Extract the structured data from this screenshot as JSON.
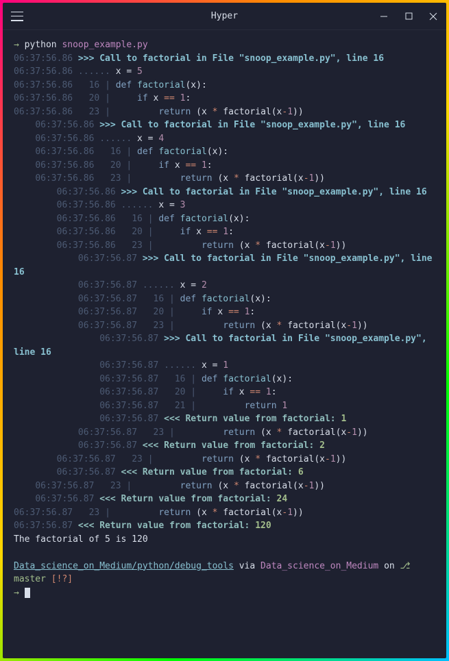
{
  "window": {
    "title": "Hyper"
  },
  "prompt": {
    "arrow": "→",
    "command": "python",
    "arg": "snoop_example.py"
  },
  "lines": [
    {
      "indent": 0,
      "ts": "06:37:56.86",
      "type": "call",
      "text": ">>> Call to factorial in File \"snoop_example.py\", line 16"
    },
    {
      "indent": 0,
      "ts": "06:37:56.86",
      "type": "var",
      "var": "x",
      "val": "5"
    },
    {
      "indent": 0,
      "ts": "06:37:56.86",
      "type": "code",
      "ln": "16",
      "parts": [
        {
          "t": "kw",
          "s": "def "
        },
        {
          "t": "fn",
          "s": "factorial"
        },
        {
          "t": "",
          "s": "(x):"
        }
      ]
    },
    {
      "indent": 0,
      "ts": "06:37:56.86",
      "type": "code",
      "ln": "20",
      "parts": [
        {
          "t": "",
          "s": "    "
        },
        {
          "t": "kw",
          "s": "if"
        },
        {
          "t": "",
          "s": " x "
        },
        {
          "t": "op",
          "s": "=="
        },
        {
          "t": "",
          "s": " "
        },
        {
          "t": "num",
          "s": "1"
        },
        {
          "t": "",
          "s": ":"
        }
      ]
    },
    {
      "indent": 0,
      "ts": "06:37:56.86",
      "type": "code",
      "ln": "23",
      "parts": [
        {
          "t": "",
          "s": "        "
        },
        {
          "t": "kw",
          "s": "return"
        },
        {
          "t": "",
          "s": " (x "
        },
        {
          "t": "op",
          "s": "*"
        },
        {
          "t": "",
          "s": " factorial(x"
        },
        {
          "t": "op",
          "s": "-"
        },
        {
          "t": "num",
          "s": "1"
        },
        {
          "t": "",
          "s": "))"
        }
      ]
    },
    {
      "indent": 1,
      "ts": "06:37:56.86",
      "type": "call",
      "text": ">>> Call to factorial in File \"snoop_example.py\", line 16"
    },
    {
      "indent": 1,
      "ts": "06:37:56.86",
      "type": "var",
      "var": "x",
      "val": "4"
    },
    {
      "indent": 1,
      "ts": "06:37:56.86",
      "type": "code",
      "ln": "16",
      "parts": [
        {
          "t": "kw",
          "s": "def "
        },
        {
          "t": "fn",
          "s": "factorial"
        },
        {
          "t": "",
          "s": "(x):"
        }
      ]
    },
    {
      "indent": 1,
      "ts": "06:37:56.86",
      "type": "code",
      "ln": "20",
      "parts": [
        {
          "t": "",
          "s": "    "
        },
        {
          "t": "kw",
          "s": "if"
        },
        {
          "t": "",
          "s": " x "
        },
        {
          "t": "op",
          "s": "=="
        },
        {
          "t": "",
          "s": " "
        },
        {
          "t": "num",
          "s": "1"
        },
        {
          "t": "",
          "s": ":"
        }
      ]
    },
    {
      "indent": 1,
      "ts": "06:37:56.86",
      "type": "code",
      "ln": "23",
      "parts": [
        {
          "t": "",
          "s": "        "
        },
        {
          "t": "kw",
          "s": "return"
        },
        {
          "t": "",
          "s": " (x "
        },
        {
          "t": "op",
          "s": "*"
        },
        {
          "t": "",
          "s": " factorial(x"
        },
        {
          "t": "op",
          "s": "-"
        },
        {
          "t": "num",
          "s": "1"
        },
        {
          "t": "",
          "s": "))"
        }
      ]
    },
    {
      "indent": 2,
      "ts": "06:37:56.86",
      "type": "call",
      "text": ">>> Call to factorial in File \"snoop_example.py\", line 16"
    },
    {
      "indent": 2,
      "ts": "06:37:56.86",
      "type": "var",
      "var": "x",
      "val": "3"
    },
    {
      "indent": 2,
      "ts": "06:37:56.86",
      "type": "code",
      "ln": "16",
      "parts": [
        {
          "t": "kw",
          "s": "def "
        },
        {
          "t": "fn",
          "s": "factorial"
        },
        {
          "t": "",
          "s": "(x):"
        }
      ]
    },
    {
      "indent": 2,
      "ts": "06:37:56.86",
      "type": "code",
      "ln": "20",
      "parts": [
        {
          "t": "",
          "s": "    "
        },
        {
          "t": "kw",
          "s": "if"
        },
        {
          "t": "",
          "s": " x "
        },
        {
          "t": "op",
          "s": "=="
        },
        {
          "t": "",
          "s": " "
        },
        {
          "t": "num",
          "s": "1"
        },
        {
          "t": "",
          "s": ":"
        }
      ]
    },
    {
      "indent": 2,
      "ts": "06:37:56.86",
      "type": "code",
      "ln": "23",
      "parts": [
        {
          "t": "",
          "s": "        "
        },
        {
          "t": "kw",
          "s": "return"
        },
        {
          "t": "",
          "s": " (x "
        },
        {
          "t": "op",
          "s": "*"
        },
        {
          "t": "",
          "s": " factorial(x"
        },
        {
          "t": "op",
          "s": "-"
        },
        {
          "t": "num",
          "s": "1"
        },
        {
          "t": "",
          "s": "))"
        }
      ]
    },
    {
      "indent": 3,
      "ts": "06:37:56.87",
      "type": "call",
      "text": ">>> Call to factorial in File \"snoop_example.py\", line 16"
    },
    {
      "indent": 3,
      "ts": "06:37:56.87",
      "type": "var",
      "var": "x",
      "val": "2"
    },
    {
      "indent": 3,
      "ts": "06:37:56.87",
      "type": "code",
      "ln": "16",
      "parts": [
        {
          "t": "kw",
          "s": "def "
        },
        {
          "t": "fn",
          "s": "factorial"
        },
        {
          "t": "",
          "s": "(x):"
        }
      ]
    },
    {
      "indent": 3,
      "ts": "06:37:56.87",
      "type": "code",
      "ln": "20",
      "parts": [
        {
          "t": "",
          "s": "    "
        },
        {
          "t": "kw",
          "s": "if"
        },
        {
          "t": "",
          "s": " x "
        },
        {
          "t": "op",
          "s": "=="
        },
        {
          "t": "",
          "s": " "
        },
        {
          "t": "num",
          "s": "1"
        },
        {
          "t": "",
          "s": ":"
        }
      ]
    },
    {
      "indent": 3,
      "ts": "06:37:56.87",
      "type": "code",
      "ln": "23",
      "parts": [
        {
          "t": "",
          "s": "        "
        },
        {
          "t": "kw",
          "s": "return"
        },
        {
          "t": "",
          "s": " (x "
        },
        {
          "t": "op",
          "s": "*"
        },
        {
          "t": "",
          "s": " factorial(x"
        },
        {
          "t": "op",
          "s": "-"
        },
        {
          "t": "num",
          "s": "1"
        },
        {
          "t": "",
          "s": "))"
        }
      ]
    },
    {
      "indent": 4,
      "ts": "06:37:56.87",
      "type": "call",
      "text": ">>> Call to factorial in File \"snoop_example.py\", line 16"
    },
    {
      "indent": 4,
      "ts": "06:37:56.87",
      "type": "var",
      "var": "x",
      "val": "1"
    },
    {
      "indent": 4,
      "ts": "06:37:56.87",
      "type": "code",
      "ln": "16",
      "parts": [
        {
          "t": "kw",
          "s": "def "
        },
        {
          "t": "fn",
          "s": "factorial"
        },
        {
          "t": "",
          "s": "(x):"
        }
      ]
    },
    {
      "indent": 4,
      "ts": "06:37:56.87",
      "type": "code",
      "ln": "20",
      "parts": [
        {
          "t": "",
          "s": "    "
        },
        {
          "t": "kw",
          "s": "if"
        },
        {
          "t": "",
          "s": " x "
        },
        {
          "t": "op",
          "s": "=="
        },
        {
          "t": "",
          "s": " "
        },
        {
          "t": "num",
          "s": "1"
        },
        {
          "t": "",
          "s": ":"
        }
      ]
    },
    {
      "indent": 4,
      "ts": "06:37:56.87",
      "type": "code",
      "ln": "21",
      "parts": [
        {
          "t": "",
          "s": "        "
        },
        {
          "t": "kw",
          "s": "return"
        },
        {
          "t": "",
          "s": " "
        },
        {
          "t": "num",
          "s": "1"
        }
      ]
    },
    {
      "indent": 4,
      "ts": "06:37:56.87",
      "type": "ret",
      "text": "<<< Return value from factorial:",
      "val": "1"
    },
    {
      "indent": 3,
      "ts": "06:37:56.87",
      "type": "code",
      "ln": "23",
      "parts": [
        {
          "t": "",
          "s": "        "
        },
        {
          "t": "kw",
          "s": "return"
        },
        {
          "t": "",
          "s": " (x "
        },
        {
          "t": "op",
          "s": "*"
        },
        {
          "t": "",
          "s": " factorial(x"
        },
        {
          "t": "op",
          "s": "-"
        },
        {
          "t": "num",
          "s": "1"
        },
        {
          "t": "",
          "s": "))"
        }
      ]
    },
    {
      "indent": 3,
      "ts": "06:37:56.87",
      "type": "ret",
      "text": "<<< Return value from factorial:",
      "val": "2"
    },
    {
      "indent": 2,
      "ts": "06:37:56.87",
      "type": "code",
      "ln": "23",
      "parts": [
        {
          "t": "",
          "s": "        "
        },
        {
          "t": "kw",
          "s": "return"
        },
        {
          "t": "",
          "s": " (x "
        },
        {
          "t": "op",
          "s": "*"
        },
        {
          "t": "",
          "s": " factorial(x"
        },
        {
          "t": "op",
          "s": "-"
        },
        {
          "t": "num",
          "s": "1"
        },
        {
          "t": "",
          "s": "))"
        }
      ]
    },
    {
      "indent": 2,
      "ts": "06:37:56.87",
      "type": "ret",
      "text": "<<< Return value from factorial:",
      "val": "6"
    },
    {
      "indent": 1,
      "ts": "06:37:56.87",
      "type": "code",
      "ln": "23",
      "parts": [
        {
          "t": "",
          "s": "        "
        },
        {
          "t": "kw",
          "s": "return"
        },
        {
          "t": "",
          "s": " (x "
        },
        {
          "t": "op",
          "s": "*"
        },
        {
          "t": "",
          "s": " factorial(x"
        },
        {
          "t": "op",
          "s": "-"
        },
        {
          "t": "num",
          "s": "1"
        },
        {
          "t": "",
          "s": "))"
        }
      ]
    },
    {
      "indent": 1,
      "ts": "06:37:56.87",
      "type": "ret",
      "text": "<<< Return value from factorial:",
      "val": "24"
    },
    {
      "indent": 0,
      "ts": "06:37:56.87",
      "type": "code",
      "ln": "23",
      "parts": [
        {
          "t": "",
          "s": "        "
        },
        {
          "t": "kw",
          "s": "return"
        },
        {
          "t": "",
          "s": " (x "
        },
        {
          "t": "op",
          "s": "*"
        },
        {
          "t": "",
          "s": " factorial(x"
        },
        {
          "t": "op",
          "s": "-"
        },
        {
          "t": "num",
          "s": "1"
        },
        {
          "t": "",
          "s": "))"
        }
      ]
    },
    {
      "indent": 0,
      "ts": "06:37:56.87",
      "type": "ret",
      "text": "<<< Return value from factorial:",
      "val": "120"
    }
  ],
  "output": "The factorial of 5 is 120",
  "ps1": {
    "path": "Data_science_on_Medium/python/debug_tools",
    "via": "via",
    "env": "Data_science_on_Medium",
    "on": "on",
    "branch_icon": "⎇",
    "branch": "master",
    "dirty": "[!?]"
  }
}
